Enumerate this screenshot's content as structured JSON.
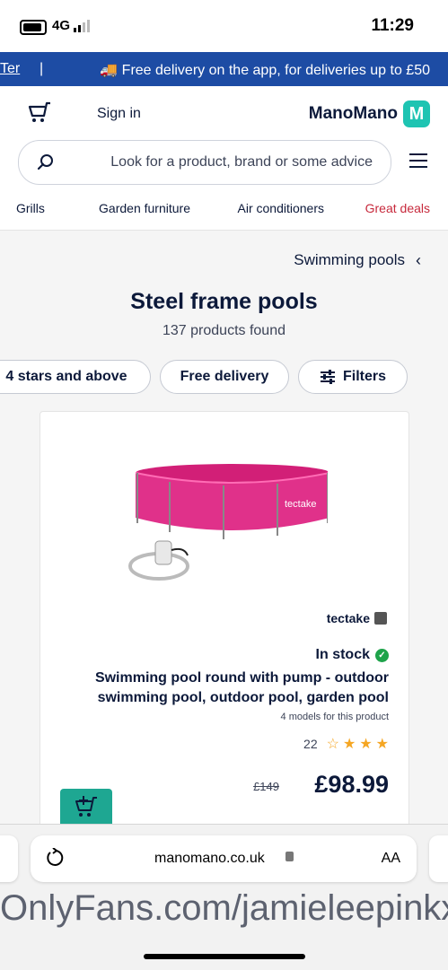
{
  "status": {
    "time": "11:29",
    "network": "4G"
  },
  "promo": {
    "text": "🚚 Free delivery on the app, for deliveries up to £50",
    "separator": "|",
    "more": "Ter"
  },
  "header": {
    "logo_mark": "M",
    "logo_text": "ManoMano",
    "signin": "Sign in",
    "search_placeholder": "Look for a product, brand or some advice",
    "categories": [
      "Great deals",
      "Air conditioners",
      "Garden furniture",
      "Grills"
    ]
  },
  "breadcrumb": {
    "back": "‹",
    "label": "Swimming pools"
  },
  "page": {
    "title": "Steel frame pools",
    "count": "137 products found"
  },
  "chips": [
    {
      "label": "Filters"
    },
    {
      "label": "Free delivery"
    },
    {
      "label": "4 stars and above"
    }
  ],
  "product": {
    "brand": "tectake",
    "stock": "In stock",
    "name": "Swimming pool round with pump - outdoor swimming pool, outdoor pool, garden pool",
    "models": "4 models for this product",
    "rating": 3.5,
    "rating_count": "22",
    "price": "£98.99",
    "old_price": "£149",
    "pool_label": "tectake"
  },
  "browser": {
    "url": "manomano.co.uk",
    "aa": "AA"
  },
  "overlay_text": "OnlyFans.com/jamieleepinkx",
  "colors": {
    "promo": "#1d4ca4",
    "accent": "#1ec4b2",
    "great_deals": "#c7293c",
    "add_to_cart": "#1ea792"
  }
}
